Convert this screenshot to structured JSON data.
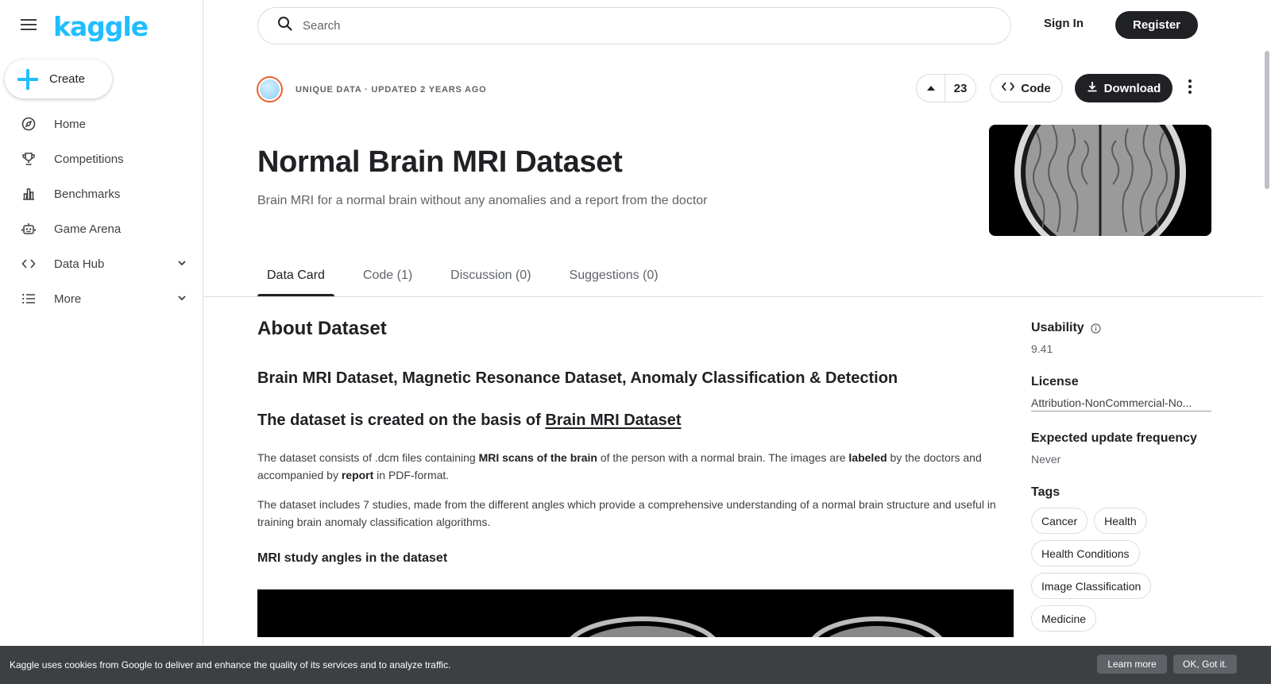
{
  "brand": {
    "logo_text": "kaggle"
  },
  "sidebar": {
    "create_label": "Create",
    "items": [
      {
        "label": "Home",
        "icon": "compass-icon"
      },
      {
        "label": "Competitions",
        "icon": "trophy-icon"
      },
      {
        "label": "Benchmarks",
        "icon": "bar-chart-icon"
      },
      {
        "label": "Game Arena",
        "icon": "robot-icon"
      },
      {
        "label": "Data Hub",
        "icon": "code-brackets-icon"
      },
      {
        "label": "More",
        "icon": "list-icon"
      }
    ]
  },
  "header": {
    "search_placeholder": "Search",
    "signin_label": "Sign In",
    "register_label": "Register"
  },
  "dataset": {
    "owner_meta": "UNIQUE DATA · UPDATED 2 YEARS AGO",
    "vote_count": "23",
    "code_label": "Code",
    "download_label": "Download",
    "title": "Normal Brain MRI Dataset",
    "subtitle": "Brain MRI for a normal brain without any anomalies and a report from the doctor"
  },
  "tabs": [
    {
      "label": "Data Card",
      "active": true
    },
    {
      "label": "Code (1)"
    },
    {
      "label": "Discussion (0)"
    },
    {
      "label": "Suggestions (0)"
    }
  ],
  "content": {
    "about_heading": "About Dataset",
    "heading1": "Brain MRI Dataset, Magnetic Resonance Dataset, Anomaly Classification & Detection",
    "heading2_prefix": "The dataset is created on the basis of ",
    "heading2_link": "Brain MRI Dataset",
    "p1_a": "The dataset consists of .dcm files containing ",
    "p1_b": "MRI scans of the brain",
    "p1_c": " of the person with a normal brain. The images are ",
    "p1_d": "labeled",
    "p1_e": " by the doctors and accompanied by ",
    "p1_f": "report",
    "p1_g": " in PDF-format.",
    "p2": "The dataset includes 7 studies, made from the different angles which provide a comprehensive understanding of a normal brain structure and useful in training brain anomaly classification algorithms.",
    "heading3": "MRI study angles in the dataset"
  },
  "aside": {
    "usability_label": "Usability",
    "usability_value": "9.41",
    "license_label": "License",
    "license_value": "Attribution-NonCommercial-No...",
    "frequency_label": "Expected update frequency",
    "frequency_value": "Never",
    "tags_label": "Tags",
    "tags": [
      "Cancer",
      "Health",
      "Health Conditions",
      "Image Classification",
      "Medicine"
    ]
  },
  "cookie": {
    "text": "Kaggle uses cookies from Google to deliver and enhance the quality of its services and to analyze traffic.",
    "learn_more": "Learn more",
    "ok": "OK, Got it."
  }
}
